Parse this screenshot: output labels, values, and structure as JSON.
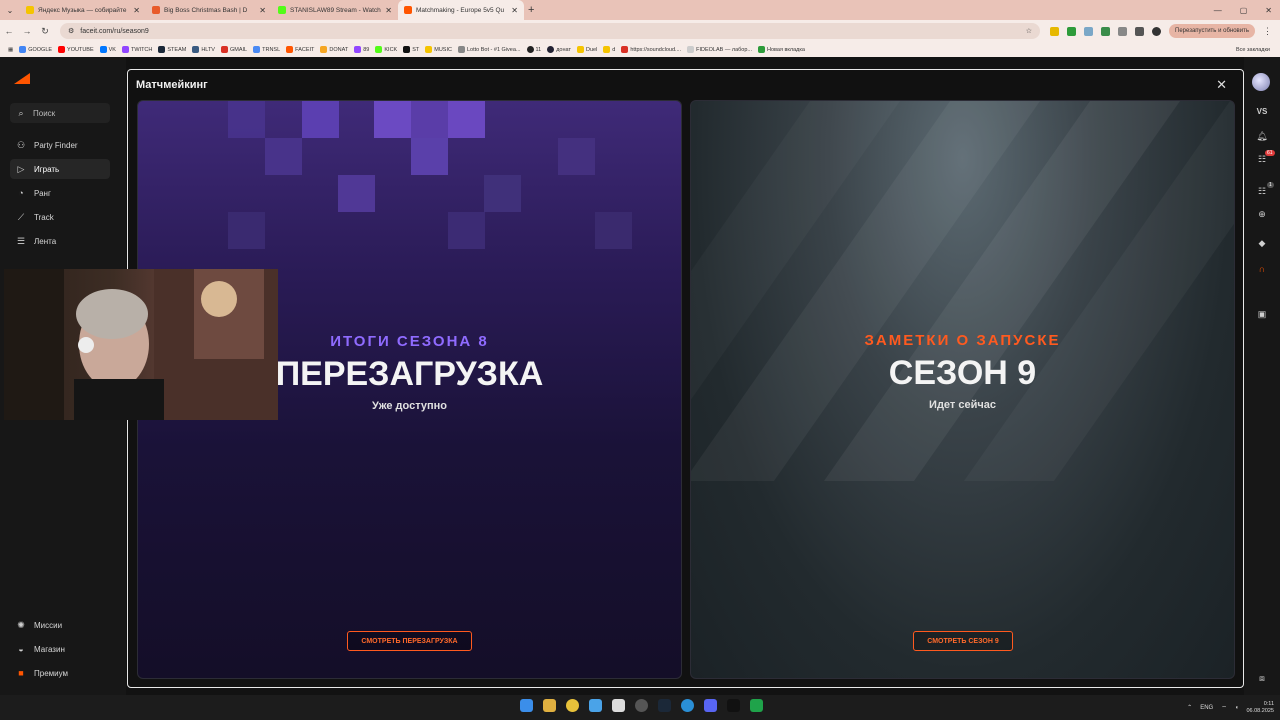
{
  "browser": {
    "tabs": [
      {
        "title": "Яндекс Музыка — собирайте",
        "active": false
      },
      {
        "title": "Big Boss Christmas Bash | D",
        "active": false
      },
      {
        "title": "STANISLAW89 Stream - Watch",
        "active": false
      },
      {
        "title": "Matchmaking - Europe 5v5 Qu",
        "active": true
      }
    ],
    "new_tab": "+",
    "url": "faceit.com/ru/season9",
    "relaunch_label": "Перезапустить и обновить",
    "bookmarks": [
      "GOOGLE",
      "YOUTUBE",
      "VK",
      "TWITCH",
      "STEAM",
      "HLTV",
      "GMAIL",
      "TRNSL",
      "FACEIT",
      "DONAT",
      "89",
      "KICK",
      "ST",
      "MUSIC",
      "Lotto Bot - #1 Givea...",
      "11",
      "донат",
      "Duel",
      "d",
      "https://soundcloud....",
      "FIDEOLAB — лабор...",
      "Новая вкладка"
    ],
    "all_bookmarks": "Все закладки"
  },
  "sidebar": {
    "search_placeholder": "Поиск",
    "items": [
      {
        "label": "Party Finder",
        "icon": "users-icon"
      },
      {
        "label": "Играть",
        "icon": "play-icon"
      },
      {
        "label": "Ранг",
        "icon": "rank-icon"
      },
      {
        "label": "Track",
        "icon": "chart-icon"
      },
      {
        "label": "Лента",
        "icon": "feed-icon"
      }
    ],
    "bottom_items": [
      {
        "label": "Миссии",
        "icon": "missions-icon"
      },
      {
        "label": "Магазин",
        "icon": "shop-icon"
      },
      {
        "label": "Премиум",
        "icon": "premium-icon"
      }
    ]
  },
  "rightbar": {
    "vs_label": "VS",
    "friends_badge": "61",
    "party_badge": "1"
  },
  "modal": {
    "title": "Матчмейкинг",
    "close": "✕",
    "left_card": {
      "eyebrow": "ИТОГИ СЕЗОНА 8",
      "title": "ПЕРЕЗАГРУЗКА",
      "subtitle": "Уже доступно",
      "button": "СМОТРЕТЬ ПЕРЕЗАГРУЗКА",
      "eyebrow_color": "#8f6bff"
    },
    "right_card": {
      "eyebrow": "ЗАМЕТКИ О ЗАПУСКЕ",
      "title": "СЕЗОН 9",
      "subtitle": "Идет сейчас",
      "button": "СМОТРЕТЬ СЕЗОН 9",
      "eyebrow_color": "#ff5a1f"
    }
  },
  "taskbar": {
    "lang": "ENG",
    "time": "0:11",
    "date": "06.08.2025"
  }
}
